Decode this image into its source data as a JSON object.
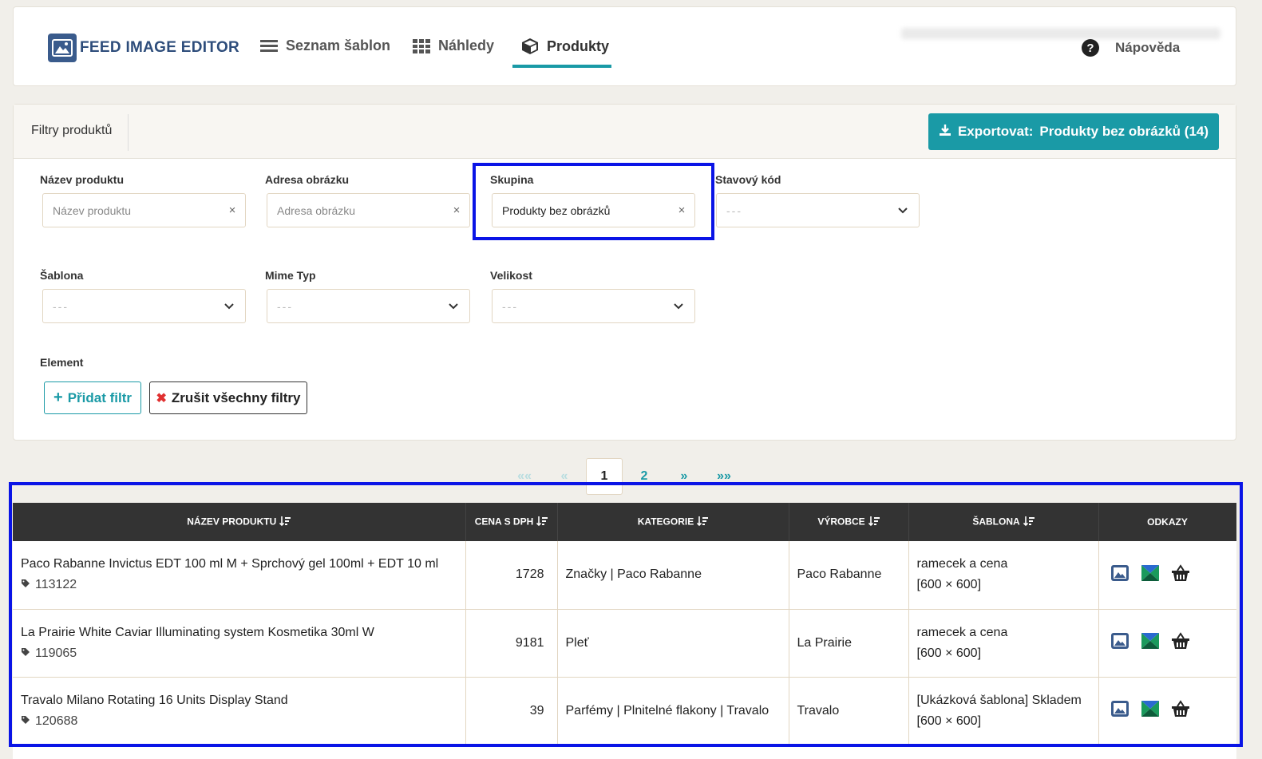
{
  "header": {
    "logo_text": "FEED IMAGE EDITOR",
    "nav": [
      {
        "label": "Seznam šablon",
        "icon": "list-icon"
      },
      {
        "label": "Náhledy",
        "icon": "grid-icon"
      },
      {
        "label": "Produkty",
        "icon": "box-icon",
        "active": true
      }
    ],
    "help_label": "Nápověda"
  },
  "filters": {
    "title": "Filtry produktů",
    "export": {
      "prefix": "Exportovat:",
      "label": "Produkty bez obrázků (14)"
    },
    "fields": {
      "nazev": {
        "label": "Název produktu",
        "placeholder": "Název produktu"
      },
      "adresa": {
        "label": "Adresa obrázku",
        "placeholder": "Adresa obrázku"
      },
      "skupina": {
        "label": "Skupina",
        "value": "Produkty bez obrázků"
      },
      "stavovy": {
        "label": "Stavový kód",
        "value": "---"
      },
      "sablona": {
        "label": "Šablona",
        "value": "---"
      },
      "mime": {
        "label": "Mime Typ",
        "value": "---"
      },
      "velikost": {
        "label": "Velikost",
        "value": "---"
      },
      "element": {
        "label": "Element"
      }
    },
    "add_filter": "Přidat filtr",
    "clear_filters": "Zrušit všechny filtry"
  },
  "pagination": {
    "first": "««",
    "prev": "«",
    "pages": [
      "1",
      "2"
    ],
    "current": "1",
    "next": "»",
    "last": "»»"
  },
  "table": {
    "columns": [
      "Název produktu",
      "Cena s DPH",
      "Kategorie",
      "Výrobce",
      "Šablona",
      "Odkazy"
    ],
    "rows": [
      {
        "name": "Paco Rabanne Invictus EDT 100 ml M + Sprchový gel 100ml + EDT 10 ml",
        "id": "113122",
        "price": "1728",
        "category": "Značky | Paco Rabanne",
        "maker": "Paco Rabanne",
        "template": "ramecek a cena",
        "size": "[600 × 600]"
      },
      {
        "name": "La Prairie White Caviar Illuminating system Kosmetika 30ml W",
        "id": "119065",
        "price": "9181",
        "category": "Pleť",
        "maker": "La Prairie",
        "template": "ramecek a cena",
        "size": "[600 × 600]"
      },
      {
        "name": "Travalo Milano Rotating 16 Units Display Stand",
        "id": "120688",
        "price": "39",
        "category": "Parfémy | Plnitelné flakony | Travalo",
        "maker": "Travalo",
        "template": "[Ukázková šablona] Skladem",
        "size": "[600 × 600]"
      }
    ]
  },
  "colors": {
    "accent": "#1a9aa6",
    "highlight": "#0a14e6",
    "header_bg": "#333333"
  }
}
